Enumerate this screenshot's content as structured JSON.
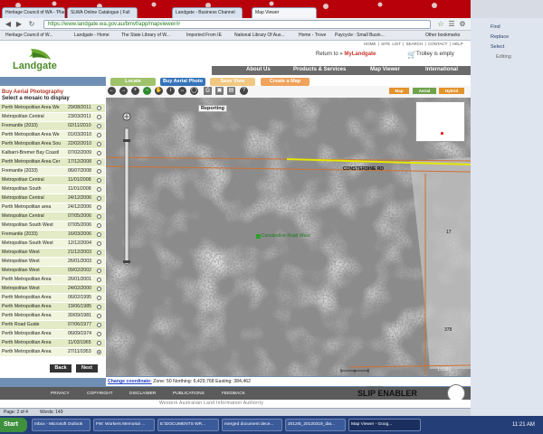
{
  "browser": {
    "tabs": [
      {
        "label": "Heritage Council of WA - 'Plac",
        "active": false
      },
      {
        "label": "SLWA Online Catalogue | Full",
        "active": false
      },
      {
        "label": "Landgate - Business Channel",
        "active": false
      },
      {
        "label": "Map Viewer",
        "active": true
      }
    ],
    "url": "https://www.landgate.wa.gov.au/bmvf/app/mapviewer/#",
    "bookmarks": [
      "Heritage Council of W...",
      "Landgate - Home",
      "The State Library of W...",
      "Imported From IE",
      "National Library Of Aus...",
      "Home - Trove",
      "Paycycle : Small Busin...",
      "Other bookmarks"
    ]
  },
  "site": {
    "logo_text": "Landgate",
    "top_links": [
      "HOME",
      "SITE LIST",
      "SEARCH",
      "CONTACT",
      "HELP"
    ],
    "return_prefix": "Return to »",
    "return_target": "MyLandgate",
    "trolley": "Trolley is empty",
    "nav": [
      "About Us",
      "Products & Services",
      "Map Viewer",
      "International"
    ]
  },
  "actions": {
    "locate": "Locate",
    "buy_aerial": "Buy Aerial Photo",
    "save_view": "Save View",
    "create_map": "Create a Map"
  },
  "map_types": [
    "Map",
    "Aerial",
    "Hybrid"
  ],
  "panel": {
    "title": "Buy Aerial Photography",
    "subtitle": "Select a mosaic to display",
    "mosaics": [
      {
        "name": "Perth Metropolitan Area We",
        "date": "29/08/2011",
        "selected": false
      },
      {
        "name": "Metropolitan Central",
        "date": "23/03/2011",
        "selected": false
      },
      {
        "name": "Fremantle (2033)",
        "date": "02/11/2010",
        "selected": false
      },
      {
        "name": "Perth Metropolitan Area We",
        "date": "01/03/2010",
        "selected": false
      },
      {
        "name": "Perth Metropolitan Area Sou",
        "date": "22/02/2010",
        "selected": false
      },
      {
        "name": "Kalbarri-Bremer Bay Coastl",
        "date": "07/02/2009",
        "selected": false
      },
      {
        "name": "Perth Metropolitan Area Cer",
        "date": "17/12/2008",
        "selected": false
      },
      {
        "name": "Fremantle (2033)",
        "date": "06/07/2008",
        "selected": false
      },
      {
        "name": "Metropolitan Central",
        "date": "11/01/2008",
        "selected": false
      },
      {
        "name": "Metropolitan South",
        "date": "11/01/2008",
        "selected": false
      },
      {
        "name": "Metropolitan Central",
        "date": "24/12/2006",
        "selected": false
      },
      {
        "name": "Perth Metropolitan area",
        "date": "24/12/2006",
        "selected": false
      },
      {
        "name": "Metropolitan Central",
        "date": "07/05/2006",
        "selected": false
      },
      {
        "name": "Metropolitan South West",
        "date": "07/05/2006",
        "selected": false
      },
      {
        "name": "Fremantle (2033)",
        "date": "16/03/2006",
        "selected": false
      },
      {
        "name": "Metropolitan South West",
        "date": "12/12/2004",
        "selected": false
      },
      {
        "name": "Metropolitan West",
        "date": "21/12/2003",
        "selected": false
      },
      {
        "name": "Metropolitan West",
        "date": "26/01/2003",
        "selected": false
      },
      {
        "name": "Metropolitan West",
        "date": "09/02/2002",
        "selected": false
      },
      {
        "name": "Perth Metropolitan Area",
        "date": "26/01/2001",
        "selected": false
      },
      {
        "name": "Metropolitan West",
        "date": "24/02/2000",
        "selected": false
      },
      {
        "name": "Perth Metropolitan Area",
        "date": "06/02/1995",
        "selected": false
      },
      {
        "name": "Perth Metropolitan Area",
        "date": "19/06/1985",
        "selected": false
      },
      {
        "name": "Perth Metropolitan Area",
        "date": "30/09/1981",
        "selected": false
      },
      {
        "name": "Perth Road Guide",
        "date": "07/06/1977",
        "selected": false
      },
      {
        "name": "Perth Metropolitan Area",
        "date": "06/09/1974",
        "selected": false
      },
      {
        "name": "Perth Metropolitan Area",
        "date": "11/03/1965",
        "selected": false
      },
      {
        "name": "Perth Metropolitan Area",
        "date": "27/11/1953",
        "selected": true
      }
    ],
    "back": "Back",
    "next": "Next"
  },
  "map": {
    "reporting": "Reporting",
    "road_label": "CONSTERDINE RD",
    "marker_label": "Consterdine Road West",
    "parcels": [
      "17",
      "378"
    ],
    "scale_label": "1:6997"
  },
  "status": {
    "link": "Change coordinate:",
    "text": "Zone: 50 Northing: 6,429,768 Easting: 384,462"
  },
  "footer": {
    "links": [
      "PRIVACY",
      "COPYRIGHT",
      "DISCLAIMER",
      "PUBLICATIONS",
      "FEEDBACK"
    ],
    "agency": "Western Australian Land Information Authority",
    "powered": "powered by",
    "slip": "SLIP ENABLER"
  },
  "word_status": {
    "page": "Page: 2 of 4",
    "words": "Words: 149"
  },
  "ribbon": {
    "find": "Find",
    "replace": "Replace",
    "select": "Select",
    "editing": "Editing"
  },
  "taskbar": {
    "start": "Start",
    "items": [
      {
        "label": "Inbox - Microsoft Outlook",
        "active": false
      },
      {
        "label": "FW: Workers Memorial ...",
        "active": false
      },
      {
        "label": "E:\\DOCUMENTS WR...",
        "active": false
      },
      {
        "label": "merged document dece...",
        "active": false
      },
      {
        "label": "2012I5_20120319_dat...",
        "active": false
      },
      {
        "label": "Map Viewer - Goog...",
        "active": true
      }
    ],
    "clock": "11:21 AM"
  }
}
